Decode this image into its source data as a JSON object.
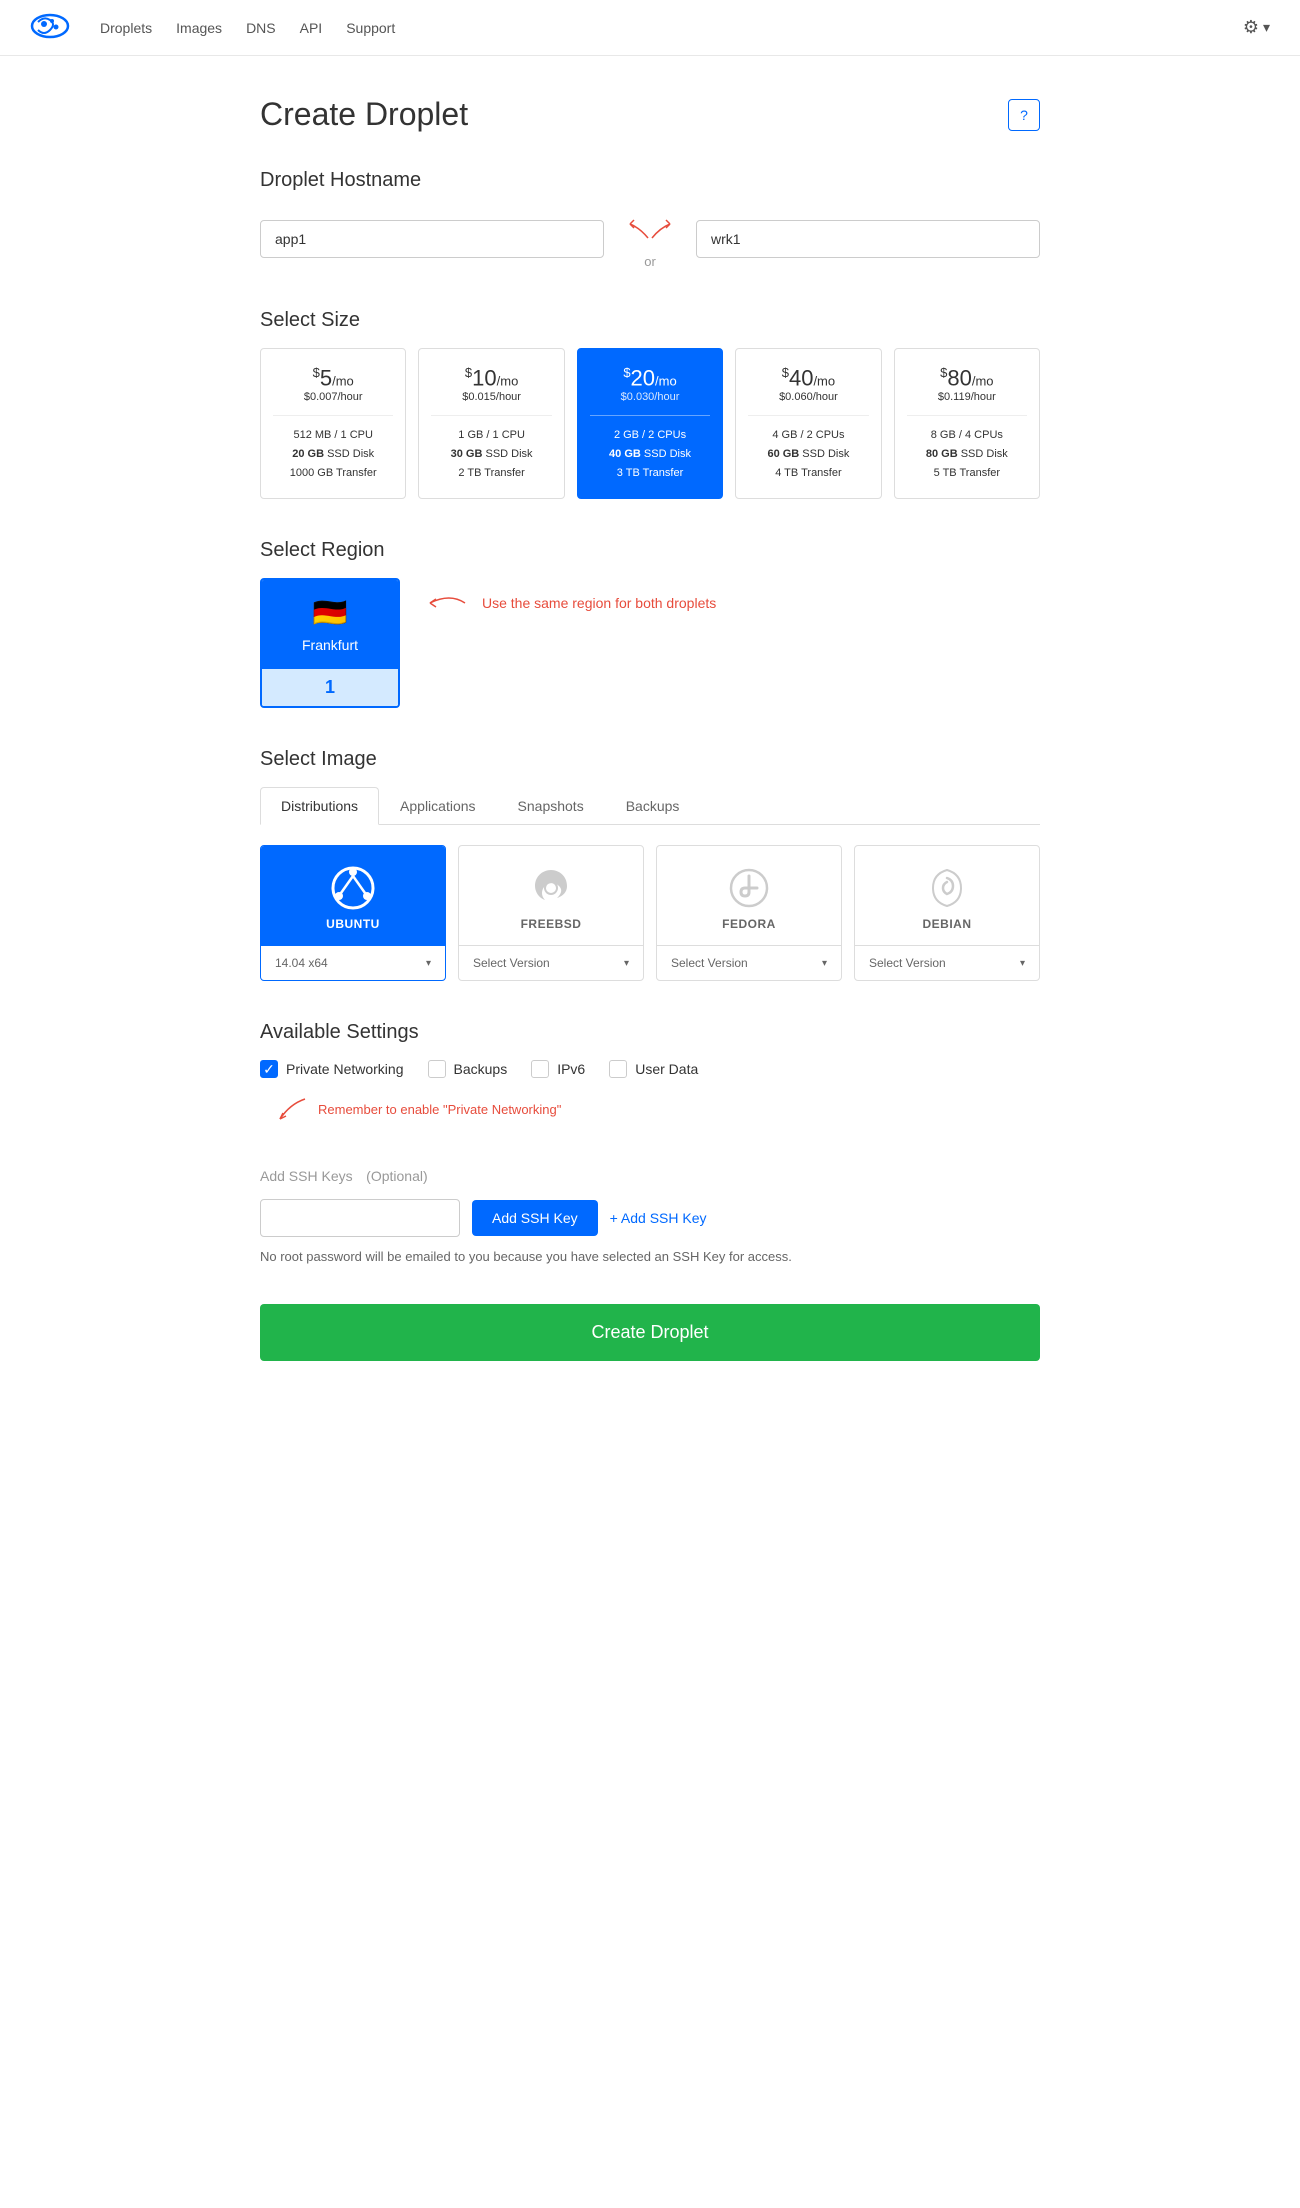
{
  "nav": {
    "links": [
      "Droplets",
      "Images",
      "DNS",
      "API",
      "Support"
    ]
  },
  "page": {
    "title": "Create Droplet",
    "help_label": "?"
  },
  "hostname": {
    "section_title": "Droplet Hostname",
    "input1_value": "app1",
    "input2_value": "wrk1",
    "or_text": "or"
  },
  "size": {
    "section_title": "Select Size",
    "cards": [
      {
        "price": "5",
        "per_mo": "/mo",
        "hourly": "$0.007/hour",
        "ram": "512 MB",
        "cpu": "1 CPU",
        "disk": "20 GB",
        "disk_type": "SSD Disk",
        "transfer": "1000 GB Transfer",
        "active": false
      },
      {
        "price": "10",
        "per_mo": "/mo",
        "hourly": "$0.015/hour",
        "ram": "1 GB",
        "cpu": "1 CPU",
        "disk": "30 GB",
        "disk_type": "SSD Disk",
        "transfer": "2 TB Transfer",
        "active": false
      },
      {
        "price": "20",
        "per_mo": "/mo",
        "hourly": "$0.030/hour",
        "ram": "2 GB",
        "cpu": "2 CPUs",
        "disk": "40 GB",
        "disk_type": "SSD Disk",
        "transfer": "3 TB Transfer",
        "active": true
      },
      {
        "price": "40",
        "per_mo": "/mo",
        "hourly": "$0.060/hour",
        "ram": "4 GB",
        "cpu": "2 CPUs",
        "disk": "60 GB",
        "disk_type": "SSD Disk",
        "transfer": "4 TB Transfer",
        "active": false
      },
      {
        "price": "80",
        "per_mo": "/mo",
        "hourly": "$0.119/hour",
        "ram": "8 GB",
        "cpu": "4 CPUs",
        "disk": "80 GB",
        "disk_type": "SSD Disk",
        "transfer": "5 TB Transfer",
        "active": false
      }
    ]
  },
  "region": {
    "section_title": "Select Region",
    "selected": "Frankfurt",
    "flag": "🇩🇪",
    "count": "1",
    "annotation": "Use the same region for both droplets"
  },
  "image": {
    "section_title": "Select Image",
    "tabs": [
      "Distributions",
      "Applications",
      "Snapshots",
      "Backups"
    ],
    "active_tab": "Distributions",
    "distributions": [
      {
        "name": "UBUNTU",
        "icon": "ubuntu",
        "version": "14.04 x64",
        "active": true
      },
      {
        "name": "FREEBSD",
        "icon": "freebsd",
        "version": "Select Version",
        "active": false
      },
      {
        "name": "FEDORA",
        "icon": "fedora",
        "version": "Select Version",
        "active": false
      },
      {
        "name": "DEBIAN",
        "icon": "debian",
        "version": "Select Version",
        "active": false
      }
    ]
  },
  "settings": {
    "section_title": "Available Settings",
    "options": [
      {
        "label": "Private Networking",
        "checked": true
      },
      {
        "label": "Backups",
        "checked": false
      },
      {
        "label": "IPv6",
        "checked": false
      },
      {
        "label": "User Data",
        "checked": false
      }
    ],
    "annotation": "Remember to enable \"Private Networking\""
  },
  "ssh": {
    "section_title": "Add SSH Keys",
    "optional_label": "(Optional)",
    "add_label": "+ Add SSH Key",
    "note": "No root password will be emailed to you because you have selected an SSH Key for access."
  },
  "footer": {
    "create_label": "Create Droplet"
  }
}
